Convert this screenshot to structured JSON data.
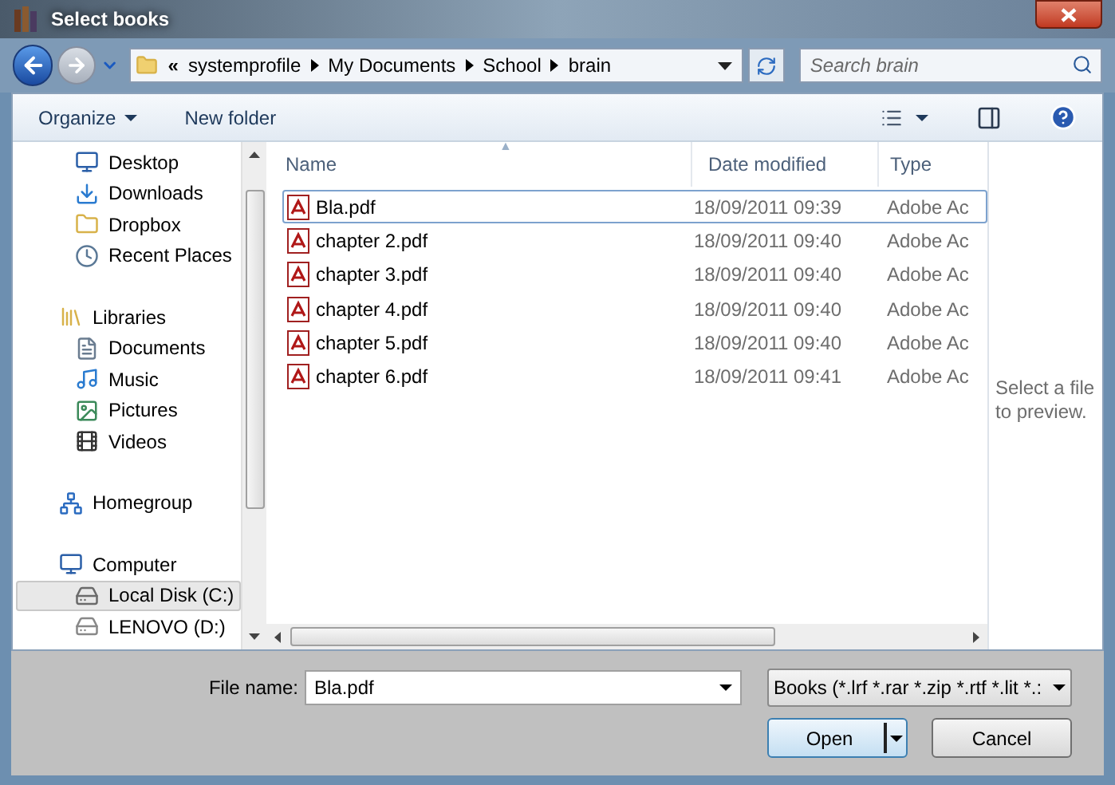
{
  "window": {
    "title": "Select books"
  },
  "address": {
    "prefix": "«",
    "crumbs": [
      "systemprofile",
      "My Documents",
      "School",
      "brain"
    ]
  },
  "search": {
    "placeholder": "Search brain"
  },
  "toolbar": {
    "organize": "Organize",
    "new_folder": "New folder"
  },
  "sidebar": {
    "sections": [
      {
        "children": [
          {
            "label": "Desktop",
            "kind": "desktop",
            "selected": false
          },
          {
            "label": "Downloads",
            "kind": "downloads",
            "selected": false
          },
          {
            "label": "Dropbox",
            "kind": "folder",
            "selected": false
          },
          {
            "label": "Recent Places",
            "kind": "recent",
            "selected": false
          }
        ]
      },
      {
        "label": "Libraries",
        "kind": "library",
        "selected": false,
        "children": [
          {
            "label": "Documents",
            "kind": "document",
            "selected": false
          },
          {
            "label": "Music",
            "kind": "music",
            "selected": false
          },
          {
            "label": "Pictures",
            "kind": "pictures",
            "selected": false
          },
          {
            "label": "Videos",
            "kind": "videos",
            "selected": false
          }
        ]
      },
      {
        "label": "Homegroup",
        "kind": "homegroup",
        "selected": false
      },
      {
        "label": "Computer",
        "kind": "computer",
        "selected": false,
        "children": [
          {
            "label": "Local Disk (C:)",
            "kind": "disk",
            "selected": true
          },
          {
            "label": "LENOVO (D:)",
            "kind": "drive",
            "selected": false
          }
        ]
      }
    ]
  },
  "table": {
    "sort_marker": "▲",
    "columns": [
      "Name",
      "Date modified",
      "Type"
    ],
    "rows": [
      {
        "name": "Bla.pdf",
        "date": "18/09/2011 09:39",
        "type": "Adobe Ac",
        "selected": true
      },
      {
        "name": "chapter 2.pdf",
        "date": "18/09/2011 09:40",
        "type": "Adobe Ac",
        "selected": false
      },
      {
        "name": "chapter 3.pdf",
        "date": "18/09/2011 09:40",
        "type": "Adobe Ac",
        "selected": false
      },
      {
        "name": "chapter 4.pdf",
        "date": "18/09/2011 09:40",
        "type": "Adobe Ac",
        "selected": false
      },
      {
        "name": "chapter 5.pdf",
        "date": "18/09/2011 09:40",
        "type": "Adobe Ac",
        "selected": false
      },
      {
        "name": "chapter 6.pdf",
        "date": "18/09/2011 09:41",
        "type": "Adobe Ac",
        "selected": false
      }
    ]
  },
  "preview": {
    "message": "Select a file to preview."
  },
  "file_name": {
    "label": "File name:",
    "value": "Bla.pdf"
  },
  "file_type": {
    "value": "Books (*.lrf *.rar *.zip *.rtf *.lit *.:"
  },
  "buttons": {
    "open": "Open",
    "cancel": "Cancel"
  }
}
